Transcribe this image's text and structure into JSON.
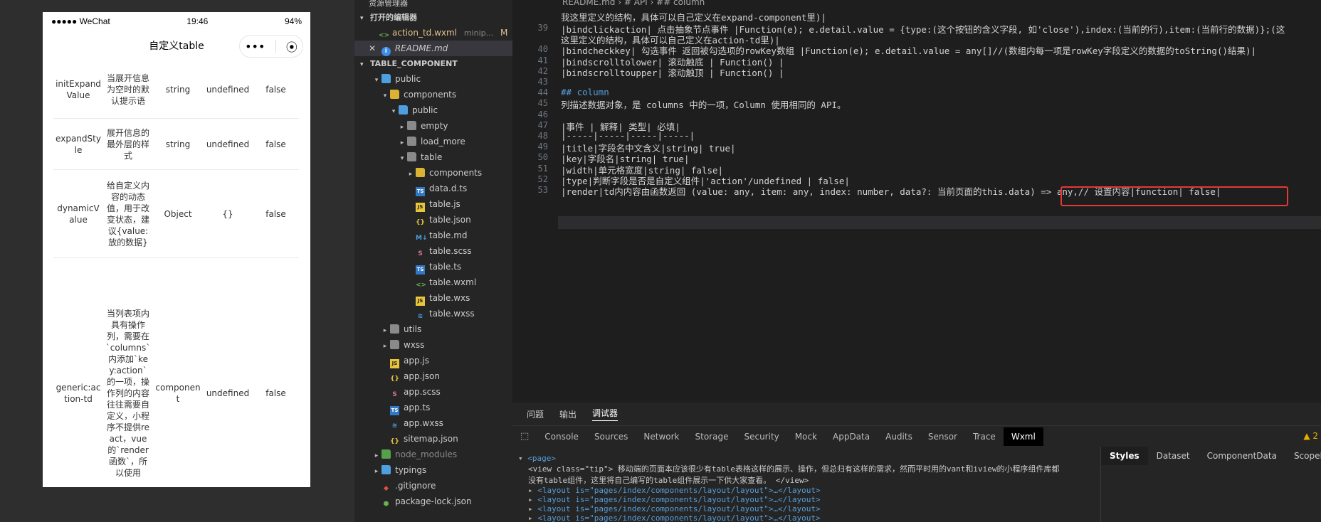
{
  "simulator": {
    "status": {
      "signal": "●●●●● WeChat",
      "time": "19:46",
      "battery": "94%"
    },
    "nav_title": "自定义table",
    "capsule": {
      "more": "•••",
      "close": "⦿"
    },
    "rows": [
      [
        "initExpandValue",
        "当展开信息为空时的默认提示语",
        "string",
        "undefined",
        "false"
      ],
      [
        "expandStyle",
        "展开信息的最外层的样式",
        "string",
        "undefined",
        "false"
      ],
      [
        "dynamicValue",
        "给自定义内容的动态值，用于改变状态，建议{value:放的数据}",
        "Object",
        "{}",
        "false"
      ],
      [
        "generic:action-td",
        "当列表项内具有操作列，需要在`columns`内添加`key:action`的一项，操作列的内容往往需要自定义，小程序不提供react，vue的`render函数`，所以使用",
        "component",
        "undefined",
        "false"
      ]
    ]
  },
  "explorer": {
    "title": "资源管理器",
    "open_editors_label": "打开的编辑器",
    "open_editors": [
      {
        "name": "action_td.wxml",
        "hint": "minip...",
        "badge": "M",
        "icon": "wxml-icon"
      },
      {
        "name": "README.md",
        "hint": "",
        "badge": "",
        "icon": "info-icon",
        "close": "✕"
      }
    ],
    "project_label": "TABLE_COMPONENT",
    "tree": [
      {
        "name": "public",
        "indent": 1,
        "caret": "▾",
        "icon": "folder-blue"
      },
      {
        "name": "components",
        "indent": 2,
        "caret": "▾",
        "icon": "folder-yellow"
      },
      {
        "name": "public",
        "indent": 3,
        "caret": "▾",
        "icon": "folder-blue"
      },
      {
        "name": "empty",
        "indent": 4,
        "caret": "▸",
        "icon": "folder"
      },
      {
        "name": "load_more",
        "indent": 4,
        "caret": "▸",
        "icon": "folder"
      },
      {
        "name": "table",
        "indent": 4,
        "caret": "▾",
        "icon": "folder"
      },
      {
        "name": "components",
        "indent": 5,
        "caret": "▸",
        "icon": "folder-yellow"
      },
      {
        "name": "data.d.ts",
        "indent": 5,
        "caret": "",
        "icon": "ts"
      },
      {
        "name": "table.js",
        "indent": 5,
        "caret": "",
        "icon": "js"
      },
      {
        "name": "table.json",
        "indent": 5,
        "caret": "",
        "icon": "json"
      },
      {
        "name": "table.md",
        "indent": 5,
        "caret": "",
        "icon": "md"
      },
      {
        "name": "table.scss",
        "indent": 5,
        "caret": "",
        "icon": "scss"
      },
      {
        "name": "table.ts",
        "indent": 5,
        "caret": "",
        "icon": "ts"
      },
      {
        "name": "table.wxml",
        "indent": 5,
        "caret": "",
        "icon": "wxml"
      },
      {
        "name": "table.wxs",
        "indent": 5,
        "caret": "",
        "icon": "js"
      },
      {
        "name": "table.wxss",
        "indent": 5,
        "caret": "",
        "icon": "wxss"
      },
      {
        "name": "utils",
        "indent": 2,
        "caret": "▸",
        "icon": "folder"
      },
      {
        "name": "wxss",
        "indent": 2,
        "caret": "▸",
        "icon": "folder"
      },
      {
        "name": "app.js",
        "indent": 2,
        "caret": "",
        "icon": "js"
      },
      {
        "name": "app.json",
        "indent": 2,
        "caret": "",
        "icon": "json"
      },
      {
        "name": "app.scss",
        "indent": 2,
        "caret": "",
        "icon": "scss"
      },
      {
        "name": "app.ts",
        "indent": 2,
        "caret": "",
        "icon": "ts"
      },
      {
        "name": "app.wxss",
        "indent": 2,
        "caret": "",
        "icon": "wxss"
      },
      {
        "name": "sitemap.json",
        "indent": 2,
        "caret": "",
        "icon": "json"
      },
      {
        "name": "node_modules",
        "indent": 1,
        "caret": "▸",
        "icon": "folder-green"
      },
      {
        "name": "typings",
        "indent": 1,
        "caret": "▸",
        "icon": "folder-blue"
      },
      {
        "name": ".gitignore",
        "indent": 1,
        "caret": "",
        "icon": "git"
      },
      {
        "name": "package-lock.json",
        "indent": 1,
        "caret": "",
        "icon": "npm"
      }
    ]
  },
  "editor": {
    "breadcrumb": "README.md › # API › ## column",
    "lines": [
      {
        "n": "39",
        "t": "|bindclickaction| 点击抽象节点事件 |Function(e); e.detail.value = {type:(这个按钮的含义字段, 如'close'),index:(当前的行),item:(当前行的数据)};(这"
      },
      {
        "n": "",
        "t": "这里定义的结构，具体可以自己定义在action-td里)|"
      },
      {
        "n": "40",
        "t": "|bindcheckkey| 勾选事件 返回被勾选项的rowKey数组 |Function(e); e.detail.value = any[]//(数组内每一项是rowKey字段定义的数据的toString()结果)|"
      },
      {
        "n": "41",
        "t": "|bindscrolltolower| 滚动触底 | Function() |"
      },
      {
        "n": "42",
        "t": "|bindscrolltoupper| 滚动触顶 | Function() |"
      },
      {
        "n": "43",
        "t": ""
      },
      {
        "n": "44",
        "t": "## column"
      },
      {
        "n": "45",
        "t": "列描述数据对象，是 columns 中的一项，Column 使用相同的 API。"
      },
      {
        "n": "46",
        "t": ""
      },
      {
        "n": "47",
        "t": "|事件 | 解释| 类型| 必填|"
      },
      {
        "n": "48",
        "t": "|-----|-----|-----|-----|"
      },
      {
        "n": "49",
        "t": "|title|字段名中文含义|string| true|"
      },
      {
        "n": "50",
        "t": "|key|字段名|string| true|"
      },
      {
        "n": "51",
        "t": "|width|单元格宽度|string| false|"
      },
      {
        "n": "52",
        "t": "|type|判断字段是否是自定义组件|'action'/undefined | false|"
      },
      {
        "n": "53",
        "t": "|render|td内内容由函数返回 (value: any, item: any, index: number, data?: 当前页面的this.data) => any,// 设置内容|function| false|"
      }
    ],
    "top_partial": "我这里定义的结构，具体可以自己定义在expand-component里)|"
  },
  "panel": {
    "tabs": [
      "问题",
      "输出",
      "调试器"
    ],
    "devtabs": [
      "Console",
      "Sources",
      "Network",
      "Storage",
      "Security",
      "Mock",
      "AppData",
      "Audits",
      "Sensor",
      "Trace",
      "Wxml"
    ],
    "warn_count": "▲ 2",
    "style_tabs": [
      "Styles",
      "Dataset",
      "ComponentData",
      "ScopeData"
    ],
    "wxml": {
      "page_tag": "<page>",
      "view_line": "<view class=\"tip\"> 移动端的页面本应该很少有table表格这样的展示、操作，但总归有这样的需求，然而平时用的vant和iview的小程序组件库都",
      "view_line2": "没有table组件，这里将自己编写的table组件展示一下供大家查看。 </view>",
      "layout_lines": [
        "<layout is=\"pages/index/components/layout/layout\">…</layout>",
        "<layout is=\"pages/index/components/layout/layout\">…</layout>",
        "<layout is=\"pages/index/components/layout/layout\">…</layout>",
        "<layout is=\"pages/index/components/layout/layout\">…</layout>"
      ]
    }
  }
}
